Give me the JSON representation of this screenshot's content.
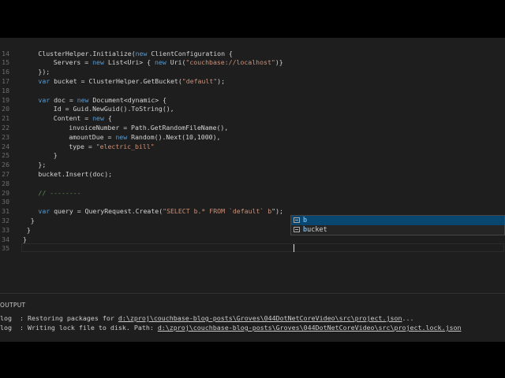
{
  "editor": {
    "lines": [
      {
        "n": "14",
        "indent": 4,
        "parts": [
          [
            "t",
            "ClusterHelper.Initialize("
          ],
          [
            "k",
            "new"
          ],
          [
            "t",
            " ClientConfiguration {"
          ]
        ]
      },
      {
        "n": "15",
        "indent": 8,
        "parts": [
          [
            "t",
            "Servers = "
          ],
          [
            "k",
            "new"
          ],
          [
            "t",
            " List<Uri> { "
          ],
          [
            "k",
            "new"
          ],
          [
            "t",
            " Uri("
          ],
          [
            "s",
            "\"couchbase://localhost\""
          ],
          [
            "t",
            ")}"
          ]
        ]
      },
      {
        "n": "16",
        "indent": 4,
        "parts": [
          [
            "t",
            "});"
          ]
        ]
      },
      {
        "n": "17",
        "indent": 4,
        "parts": [
          [
            "k",
            "var"
          ],
          [
            "t",
            " bucket = ClusterHelper.GetBucket("
          ],
          [
            "s",
            "\"default\""
          ],
          [
            "t",
            ");"
          ]
        ]
      },
      {
        "n": "18",
        "indent": 0,
        "parts": []
      },
      {
        "n": "19",
        "indent": 4,
        "parts": [
          [
            "k",
            "var"
          ],
          [
            "t",
            " doc = "
          ],
          [
            "k",
            "new"
          ],
          [
            "t",
            " Document<dynamic> {"
          ]
        ]
      },
      {
        "n": "20",
        "indent": 8,
        "parts": [
          [
            "t",
            "Id = Guid.NewGuid().ToString(),"
          ]
        ]
      },
      {
        "n": "21",
        "indent": 8,
        "parts": [
          [
            "t",
            "Content = "
          ],
          [
            "k",
            "new"
          ],
          [
            "t",
            " {"
          ]
        ]
      },
      {
        "n": "22",
        "indent": 12,
        "parts": [
          [
            "t",
            "invoiceNumber = Path.GetRandomFileName(),"
          ]
        ]
      },
      {
        "n": "23",
        "indent": 12,
        "parts": [
          [
            "t",
            "amountDue = "
          ],
          [
            "k",
            "new"
          ],
          [
            "t",
            " Random().Next(10,1000),"
          ]
        ]
      },
      {
        "n": "24",
        "indent": 12,
        "parts": [
          [
            "t",
            "type = "
          ],
          [
            "s",
            "\"electric_bill\""
          ]
        ]
      },
      {
        "n": "25",
        "indent": 8,
        "parts": [
          [
            "t",
            "}"
          ]
        ]
      },
      {
        "n": "26",
        "indent": 4,
        "parts": [
          [
            "t",
            "};"
          ]
        ]
      },
      {
        "n": "27",
        "indent": 4,
        "parts": [
          [
            "t",
            "bucket.Insert(doc);"
          ]
        ]
      },
      {
        "n": "28",
        "indent": 0,
        "parts": []
      },
      {
        "n": "29",
        "indent": 4,
        "parts": [
          [
            "c",
            "// --------"
          ]
        ]
      },
      {
        "n": "30",
        "indent": 0,
        "parts": []
      },
      {
        "n": "31",
        "indent": 4,
        "parts": [
          [
            "k",
            "var"
          ],
          [
            "t",
            " query = QueryRequest.Create("
          ],
          [
            "s",
            "\"SELECT b.* FROM `default` b"
          ],
          [
            "t",
            "\");"
          ]
        ]
      },
      {
        "n": "32",
        "indent": 2,
        "parts": [
          [
            "t",
            "}"
          ]
        ]
      },
      {
        "n": "33",
        "indent": 1,
        "parts": [
          [
            "t",
            "}"
          ]
        ]
      },
      {
        "n": "34",
        "indent": 0,
        "parts": [
          [
            "t",
            "}"
          ]
        ]
      },
      {
        "n": "35",
        "indent": 0,
        "parts": []
      }
    ]
  },
  "suggest": {
    "items": [
      {
        "match": "b",
        "rest": ""
      },
      {
        "match": "b",
        "rest": "ucket"
      }
    ]
  },
  "panel": {
    "title": "OUTPUT",
    "lines": [
      {
        "prefix": "log  : Restoring packages for ",
        "path": "d:\\zproj\\couchbase-blog-posts\\Groves\\044DotNetCoreVideo\\src\\project.json",
        "suffix": "..."
      },
      {
        "prefix": "log  : Writing lock file to disk. Path: ",
        "path": "d:\\zproj\\couchbase-blog-posts\\Groves\\044DotNetCoreVideo\\src\\project.lock.json",
        "suffix": ""
      }
    ]
  }
}
